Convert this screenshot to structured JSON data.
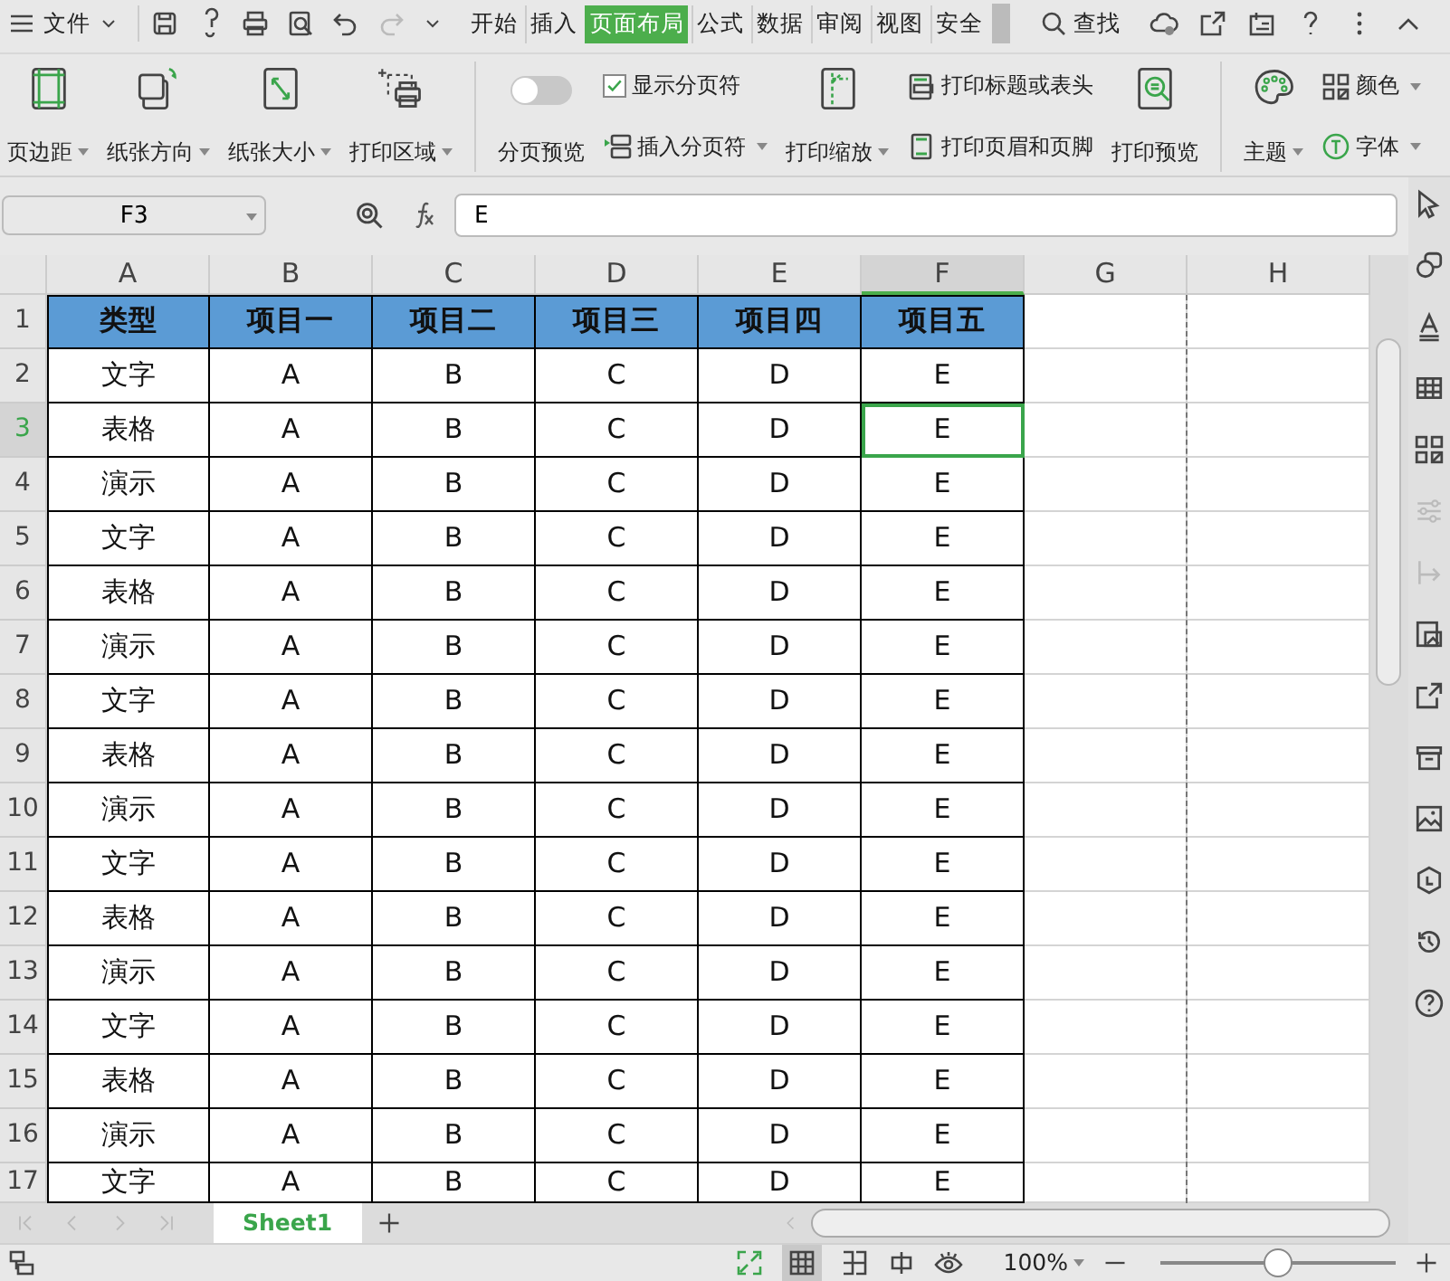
{
  "menu": {
    "label": "文件"
  },
  "menu_tabs": [
    {
      "label": "开始",
      "selected": false
    },
    {
      "label": "插入",
      "selected": false
    },
    {
      "label": "页面布局",
      "selected": true
    },
    {
      "label": "公式",
      "selected": false
    },
    {
      "label": "数据",
      "selected": false
    },
    {
      "label": "审阅",
      "selected": false
    },
    {
      "label": "视图",
      "selected": false
    },
    {
      "label": "安全",
      "selected": false
    }
  ],
  "search": {
    "label": "查找"
  },
  "ribbon": {
    "items": [
      {
        "kind": "large",
        "label": "页边距",
        "dropdown": true
      },
      {
        "kind": "large",
        "label": "纸张方向",
        "dropdown": true
      },
      {
        "kind": "large",
        "label": "纸张大小",
        "dropdown": true
      },
      {
        "kind": "large",
        "label": "打印区域",
        "dropdown": true
      },
      {
        "kind": "toggle",
        "label": "分页预览",
        "on": false
      },
      {
        "kind": "pair",
        "top": {
          "kind": "check",
          "label": "显示分页符",
          "checked": true
        },
        "bottom": {
          "kind": "small",
          "label": "插入分页符",
          "dropdown": true
        }
      },
      {
        "kind": "large",
        "label": "打印缩放",
        "dropdown": true
      },
      {
        "kind": "pair",
        "top": {
          "kind": "small",
          "label": "打印标题或表头",
          "dropdown": false
        },
        "bottom": {
          "kind": "small",
          "label": "打印页眉和页脚",
          "dropdown": false
        }
      },
      {
        "kind": "large",
        "label": "打印预览",
        "dropdown": false
      },
      {
        "kind": "large",
        "label": "主题",
        "dropdown": true
      },
      {
        "kind": "pair",
        "top": {
          "kind": "small",
          "label": "颜色",
          "dropdown": true
        },
        "bottom": {
          "kind": "small",
          "label": "字体",
          "dropdown": true
        }
      }
    ]
  },
  "formula_bar": {
    "cell_ref": "F3",
    "value": "E"
  },
  "sheet": {
    "columns": [
      {
        "label": "A",
        "selected": false
      },
      {
        "label": "B",
        "selected": false
      },
      {
        "label": "C",
        "selected": false
      },
      {
        "label": "D",
        "selected": false
      },
      {
        "label": "E",
        "selected": false
      },
      {
        "label": "F",
        "selected": true
      },
      {
        "label": "G",
        "selected": false
      },
      {
        "label": "H",
        "selected": false
      }
    ],
    "rows": [
      {
        "number": "1",
        "kind": "header",
        "selected": false,
        "cells": [
          "类型",
          "项目一",
          "项目二",
          "项目三",
          "项目四",
          "项目五"
        ]
      },
      {
        "number": "2",
        "kind": "data",
        "selected": false,
        "cells": [
          "文字",
          "A",
          "B",
          "C",
          "D",
          "E"
        ]
      },
      {
        "number": "3",
        "kind": "data",
        "selected": true,
        "cells": [
          "表格",
          "A",
          "B",
          "C",
          "D",
          "E"
        ]
      },
      {
        "number": "4",
        "kind": "data",
        "selected": false,
        "cells": [
          "演示",
          "A",
          "B",
          "C",
          "D",
          "E"
        ]
      },
      {
        "number": "5",
        "kind": "data",
        "selected": false,
        "cells": [
          "文字",
          "A",
          "B",
          "C",
          "D",
          "E"
        ]
      },
      {
        "number": "6",
        "kind": "data",
        "selected": false,
        "cells": [
          "表格",
          "A",
          "B",
          "C",
          "D",
          "E"
        ]
      },
      {
        "number": "7",
        "kind": "data",
        "selected": false,
        "cells": [
          "演示",
          "A",
          "B",
          "C",
          "D",
          "E"
        ]
      },
      {
        "number": "8",
        "kind": "data",
        "selected": false,
        "cells": [
          "文字",
          "A",
          "B",
          "C",
          "D",
          "E"
        ]
      },
      {
        "number": "9",
        "kind": "data",
        "selected": false,
        "cells": [
          "表格",
          "A",
          "B",
          "C",
          "D",
          "E"
        ]
      },
      {
        "number": "10",
        "kind": "data",
        "selected": false,
        "cells": [
          "演示",
          "A",
          "B",
          "C",
          "D",
          "E"
        ]
      },
      {
        "number": "11",
        "kind": "data",
        "selected": false,
        "cells": [
          "文字",
          "A",
          "B",
          "C",
          "D",
          "E"
        ]
      },
      {
        "number": "12",
        "kind": "data",
        "selected": false,
        "cells": [
          "表格",
          "A",
          "B",
          "C",
          "D",
          "E"
        ]
      },
      {
        "number": "13",
        "kind": "data",
        "selected": false,
        "cells": [
          "演示",
          "A",
          "B",
          "C",
          "D",
          "E"
        ]
      },
      {
        "number": "14",
        "kind": "data",
        "selected": false,
        "cells": [
          "文字",
          "A",
          "B",
          "C",
          "D",
          "E"
        ]
      },
      {
        "number": "15",
        "kind": "data",
        "selected": false,
        "cells": [
          "表格",
          "A",
          "B",
          "C",
          "D",
          "E"
        ]
      },
      {
        "number": "16",
        "kind": "data",
        "selected": false,
        "cells": [
          "演示",
          "A",
          "B",
          "C",
          "D",
          "E"
        ]
      },
      {
        "number": "17",
        "kind": "data",
        "selected": false,
        "cells": [
          "文字",
          "A",
          "B",
          "C",
          "D",
          "E"
        ]
      }
    ]
  },
  "sheet_tabs": [
    {
      "label": "Sheet1",
      "selected": true
    }
  ],
  "status_bar": {
    "zoom": "100%",
    "zoom_slider": {
      "level": 0.5
    }
  }
}
